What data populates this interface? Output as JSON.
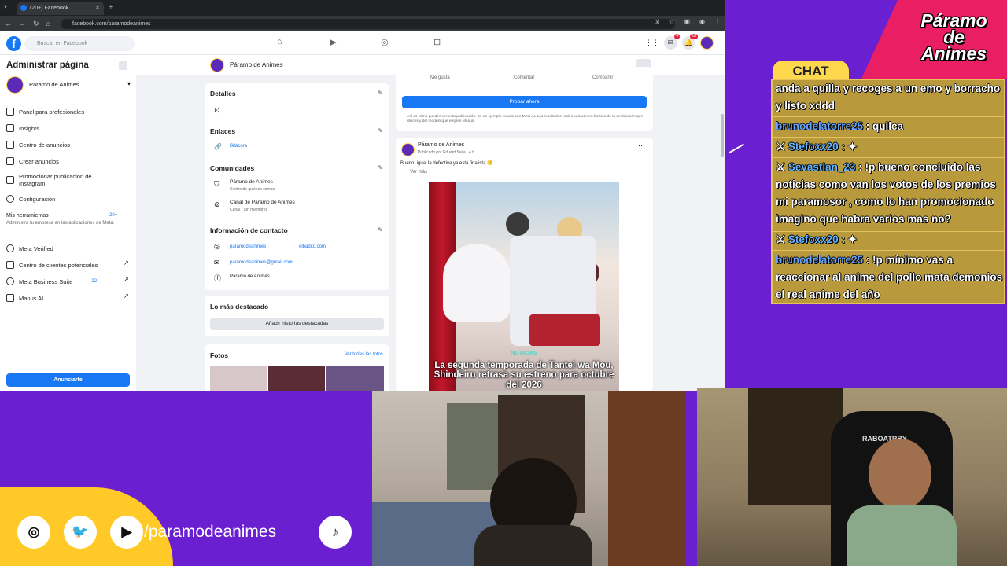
{
  "browser": {
    "tab_title": "(20+) Facebook",
    "url": "facebook.com/paramodeanimes"
  },
  "fb": {
    "search_placeholder": "Buscar en Facebook",
    "notif_badge_1": "4",
    "notif_badge_2": "18",
    "sidebar": {
      "title": "Administrar página",
      "page_name": "Páramo de Animes",
      "items": [
        "Panel para profesionales",
        "Insights",
        "Centro de anuncios",
        "Crear anuncios",
        "Promocionar publicación de Instagram",
        "Configuración"
      ],
      "tools_title": "Mis herramientas",
      "tools_badge": "20+",
      "tools_desc": "Administra tu empresa en las aplicaciones de Meta.",
      "tools": [
        "Meta Verified",
        "Centro de clientes potenciales",
        "Meta Business Suite",
        "Manus AI"
      ],
      "business_badge": "22",
      "promote_button": "Anunciarte"
    },
    "page_header": "Páramo de Animes",
    "details": {
      "title": "Detalles",
      "links_title": "Enlaces",
      "link": "Bitácora",
      "communities_title": "Comunidades",
      "community1": "Páramo de Animes",
      "community1_sub": "Centro de quiénes somos",
      "community2": "Canal de Páramo de Animes",
      "community2_sub": "Canal · Sin miembros",
      "contact_title": "Información de contacto",
      "ig1": "paramodeanimes",
      "ig2": "elbadito.com",
      "email": "paramodeanimes@gmail.com",
      "fb": "Páramo de Animes"
    },
    "highlights": {
      "title": "Lo más destacado",
      "button": "Añadir historias destacadas"
    },
    "photos": {
      "title": "Fotos",
      "see_all": "Ver todas las fotos"
    },
    "top_actions": [
      "Me gusta",
      "Comentar",
      "Compartir"
    ],
    "try_button": "Probar ahora",
    "disclaimer": "Así es cómo puedes ver esta publicación. Es un ejemplo creado con Meta AI. Los resultados reales variarán en función de la destinación que utilices y del modelo que emplee Manus.",
    "post": {
      "author": "Páramo de Animes",
      "meta": "Publicado por Eduard Seija · 4 h",
      "text": "Bueno, igual la defectiva ya está finalista 🙂",
      "see_more": "Ver más",
      "image_tag": "NOTICIAS",
      "image_title": "La segunda temporada de Tantei wa Mou, Shindeiru retrasa su estreno para octubre del 2026"
    }
  },
  "overlay": {
    "logo": [
      "Páramo",
      "de",
      "Animes"
    ],
    "chat_tag": "CHAT",
    "messages": [
      {
        "user": "",
        "text": "anda a quilla y recoges a un emo y borracho y listo xddd"
      },
      {
        "user": "brunodelatorre25",
        "text": ": quilca"
      },
      {
        "user": "Stefoxx20",
        "text": ":"
      },
      {
        "user": "Sevastian_23",
        "text": ": !p bueno concluido las noticias como van los votos de los premios mi paramosor , como lo han promocionado imagino que habra varios mas no?"
      },
      {
        "user": "Stefoxx20",
        "text": ":"
      },
      {
        "user": "brunodelatorre25",
        "text": ": !p mínimo vas a reaccionar al anime del pollo mata demonios el real anime del año"
      }
    ],
    "social_handle": "/paramodeanimes",
    "cam2_chair_text": "RABOATRBY"
  }
}
